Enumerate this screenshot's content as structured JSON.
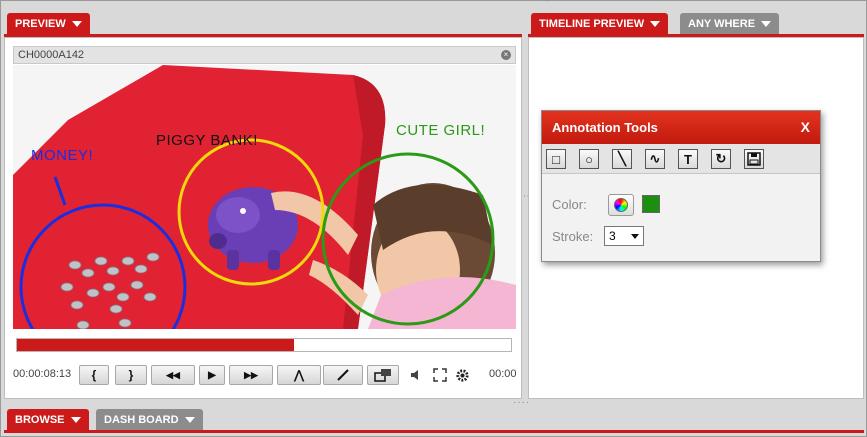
{
  "tabs_top_left": [
    {
      "label": "PREVIEW",
      "active": true
    }
  ],
  "tabs_top_right": [
    {
      "label": "TIMELINE PREVIEW",
      "active": true
    },
    {
      "label": "ANY WHERE",
      "active": false
    }
  ],
  "tabs_bottom": [
    {
      "label": "BROWSE",
      "active": true
    },
    {
      "label": "DASH BOARD",
      "active": false
    }
  ],
  "video": {
    "clip_id": "CH0000A142",
    "annotations": [
      {
        "text": "MONEY!",
        "color": "#1a2ee0"
      },
      {
        "text": "PIGGY BANK!",
        "color": "#111111"
      },
      {
        "text": "CUTE GIRL!",
        "color": "#2b9a16"
      }
    ],
    "progress": 0.56,
    "current_time": "00:00:08:13",
    "end_time": "00:00"
  },
  "controls": {
    "mark_in": "{",
    "mark_out": "}",
    "rewind": "◀◀",
    "play": "▶",
    "fast_forward": "▶▶",
    "up": "⋀"
  },
  "annotation_tools": {
    "title": "Annotation Tools",
    "close": "X",
    "tools": [
      {
        "name": "rectangle",
        "glyph": "□"
      },
      {
        "name": "circle",
        "glyph": "○"
      },
      {
        "name": "line",
        "glyph": "╲"
      },
      {
        "name": "freehand",
        "glyph": "∿"
      },
      {
        "name": "text",
        "glyph": "T"
      },
      {
        "name": "rotate",
        "glyph": "↻"
      },
      {
        "name": "save",
        "glyph": "💾"
      }
    ],
    "color_label": "Color:",
    "selected_color": "#1c8f10",
    "stroke_label": "Stroke:",
    "stroke_value": "3"
  },
  "colors": {
    "accent": "#cc1a1a",
    "tab_inactive": "#8c8c8c"
  }
}
